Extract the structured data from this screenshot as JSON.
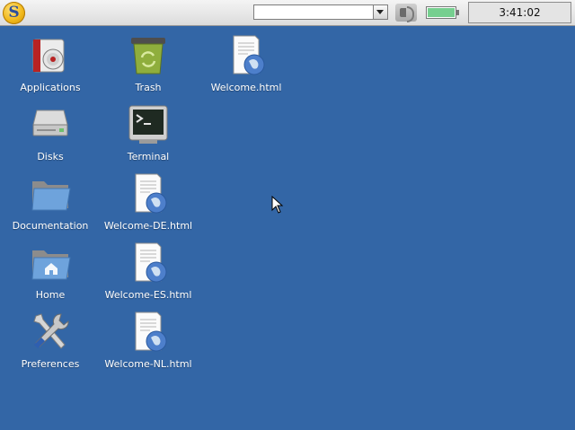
{
  "taskbar": {
    "start_icon": "s-logo-icon",
    "search_value": "",
    "volume_icon": "speaker-icon",
    "battery_level": 1.0,
    "battery_color": "#76cf8f",
    "clock": "3:41:02"
  },
  "desktop": {
    "background": "#3366a6",
    "icons": [
      {
        "label": "Applications",
        "icon": "applications-icon"
      },
      {
        "label": "Trash",
        "icon": "trash-icon"
      },
      {
        "label": "Welcome.html",
        "icon": "html-document-icon"
      },
      {
        "label": "Disks",
        "icon": "disk-drive-icon"
      },
      {
        "label": "Terminal",
        "icon": "terminal-icon"
      },
      {
        "label": "Documentation",
        "icon": "folder-icon"
      },
      {
        "label": "Welcome-DE.html",
        "icon": "html-document-icon"
      },
      {
        "label": "Home",
        "icon": "home-folder-icon"
      },
      {
        "label": "Welcome-ES.html",
        "icon": "html-document-icon"
      },
      {
        "label": "Preferences",
        "icon": "preferences-icon"
      },
      {
        "label": "Welcome-NL.html",
        "icon": "html-document-icon"
      }
    ]
  }
}
